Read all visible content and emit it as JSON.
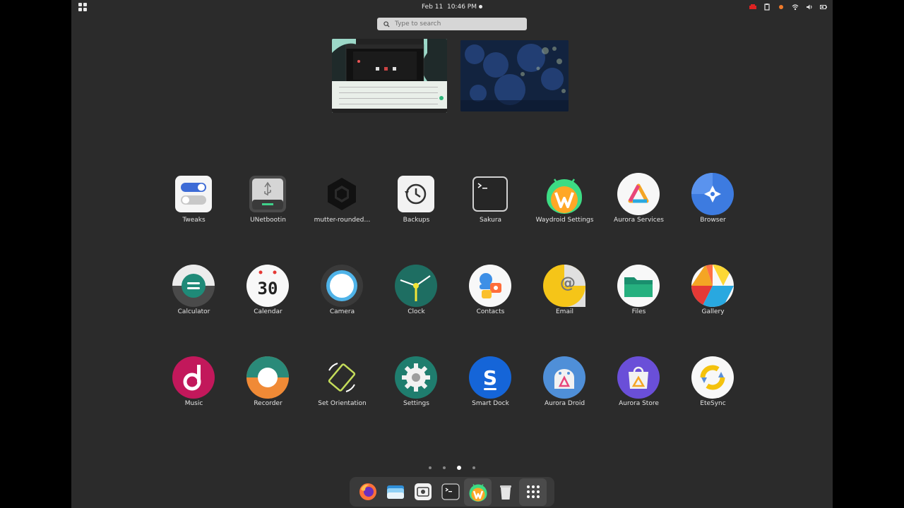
{
  "topbar": {
    "date": "Feb 11",
    "time": "10:46 PM"
  },
  "search": {
    "placeholder": "Type to search"
  },
  "apps": [
    {
      "label": "Tweaks",
      "icon": "tweaks-icon"
    },
    {
      "label": "UNetbootin",
      "icon": "unetbootin-icon"
    },
    {
      "label": "mutter-rounded…",
      "icon": "mutter-rounded-icon"
    },
    {
      "label": "Backups",
      "icon": "backups-icon"
    },
    {
      "label": "Sakura",
      "icon": "sakura-terminal-icon"
    },
    {
      "label": "Waydroid Settings",
      "icon": "waydroid-icon"
    },
    {
      "label": "Aurora Services",
      "icon": "aurora-services-icon"
    },
    {
      "label": "Browser",
      "icon": "browser-icon"
    },
    {
      "label": "Calculator",
      "icon": "calculator-icon"
    },
    {
      "label": "Calendar",
      "icon": "calendar-icon",
      "day": "30"
    },
    {
      "label": "Camera",
      "icon": "camera-icon"
    },
    {
      "label": "Clock",
      "icon": "clock-icon"
    },
    {
      "label": "Contacts",
      "icon": "contacts-icon"
    },
    {
      "label": "Email",
      "icon": "email-icon"
    },
    {
      "label": "Files",
      "icon": "files-icon"
    },
    {
      "label": "Gallery",
      "icon": "gallery-icon"
    },
    {
      "label": "Music",
      "icon": "music-icon"
    },
    {
      "label": "Recorder",
      "icon": "recorder-icon"
    },
    {
      "label": "Set Orientation",
      "icon": "orientation-icon"
    },
    {
      "label": "Settings",
      "icon": "settings-icon"
    },
    {
      "label": "Smart Dock",
      "icon": "smart-dock-icon"
    },
    {
      "label": "Aurora Droid",
      "icon": "aurora-droid-icon"
    },
    {
      "label": "Aurora Store",
      "icon": "aurora-store-icon"
    },
    {
      "label": "EteSync",
      "icon": "etesync-icon"
    }
  ],
  "pager": {
    "pages": 4,
    "current": 3
  },
  "dock": [
    "firefox-icon",
    "files-folder-icon",
    "screenshot-icon",
    "terminal-icon",
    "waydroid-icon",
    "trash-icon",
    "app-grid-icon"
  ]
}
